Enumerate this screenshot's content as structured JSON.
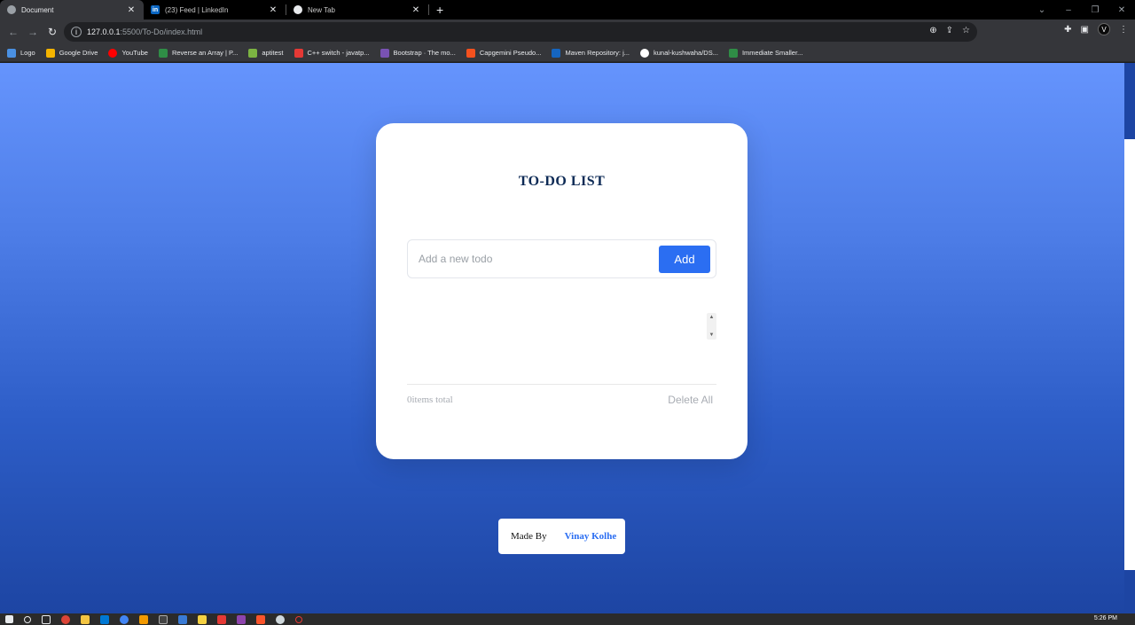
{
  "browser": {
    "tabs": [
      {
        "title": "Document",
        "active": true
      },
      {
        "title": "(23) Feed | LinkedIn",
        "active": false
      },
      {
        "title": "New Tab",
        "active": false
      }
    ],
    "url_host": "127.0.0.1",
    "url_path": ":5500/To-Do/index.html",
    "bookmarks": [
      {
        "label": "Logo",
        "color": "#4a90e2"
      },
      {
        "label": "Google Drive",
        "color": "#f4b400"
      },
      {
        "label": "YouTube",
        "color": "#ff0000"
      },
      {
        "label": "Reverse an Array | P...",
        "color": "#2f8d46"
      },
      {
        "label": "aptitest",
        "color": "#7cb342"
      },
      {
        "label": "C++ switch - javatp...",
        "color": "#e53935"
      },
      {
        "label": "Bootstrap · The mo...",
        "color": "#7952b3"
      },
      {
        "label": "Capgemini Pseudo...",
        "color": "#f4511e"
      },
      {
        "label": "Maven Repository: j...",
        "color": "#1565c0"
      },
      {
        "label": "kunal-kushwaha/DS...",
        "color": "#ffffff"
      },
      {
        "label": "Immediate Smaller...",
        "color": "#2f8d46"
      }
    ],
    "profile_initial": "V"
  },
  "app": {
    "title": "TO-DO LIST",
    "input_placeholder": "Add a new todo",
    "add_label": "Add",
    "count_text": "0items total",
    "delete_all_label": "Delete All",
    "made_by_label": "Made By",
    "author": "Vinay Kolhe",
    "accent": "#2b6ef2"
  },
  "taskbar": {
    "time": "5:26 PM"
  }
}
